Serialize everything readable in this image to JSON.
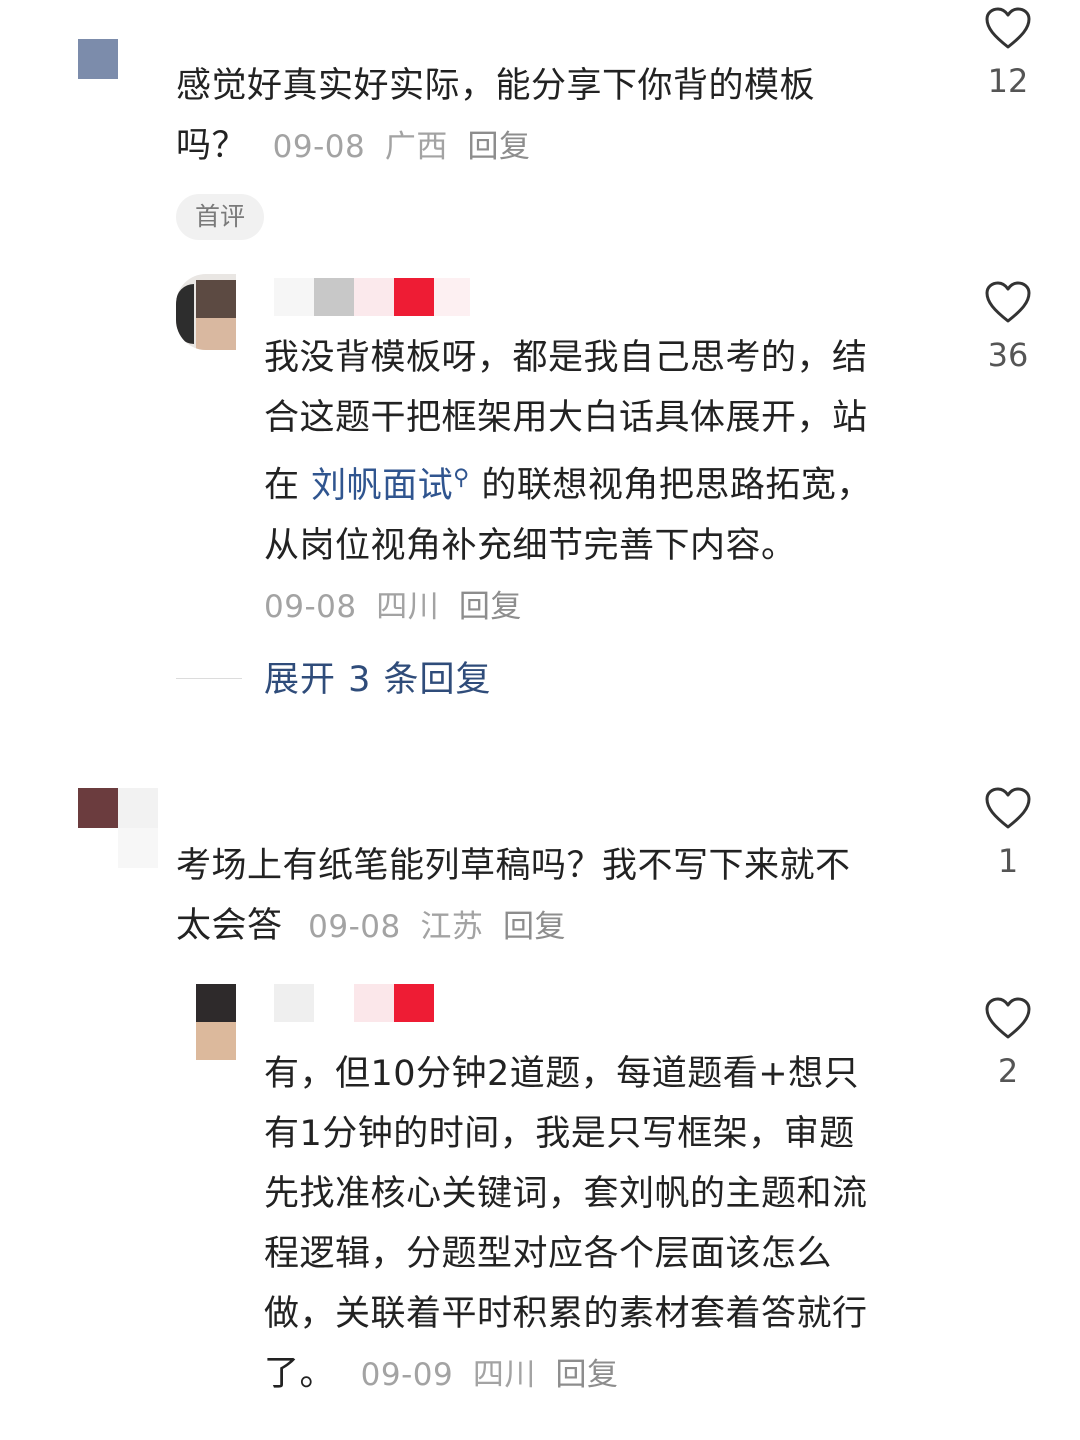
{
  "comments": [
    {
      "text_line1": "感觉好真实好实际，能分享下你背的模板",
      "text_line2": "吗？",
      "date": "09-08",
      "location": "广西",
      "reply_label": "回复",
      "likes": "12",
      "badge": "首评",
      "replies": [
        {
          "line1": "我没背模板呀，都是我自己思考的，结",
          "line2": "合这题干把框架用大白话具体展开，站",
          "line3_prefix": "在 ",
          "mention": "刘帆面试",
          "line3_suffix": " 的联想视角把思路拓宽，",
          "line4": "从岗位视角补充细节完善下内容。",
          "date": "09-08",
          "location": "四川",
          "reply_label": "回复",
          "likes": "36"
        }
      ],
      "expand_label": "展开 3 条回复"
    },
    {
      "text_line1": "考场上有纸笔能列草稿吗？我不写下来就不",
      "text_line2": "太会答",
      "date": "09-08",
      "location": "江苏",
      "reply_label": "回复",
      "likes": "1",
      "replies": [
        {
          "line1": "有，但10分钟2道题，每道题看+想只",
          "line2": "有1分钟的时间，我是只写框架，审题",
          "line3": "先找准核心关键词，套刘帆的主题和流",
          "line4": "程逻辑，分题型对应各个层面该怎么",
          "line5": "做，关联着平时积累的素材套着答就行",
          "line6": "了。",
          "date": "09-09",
          "location": "四川",
          "reply_label": "回复",
          "likes": "2"
        }
      ]
    }
  ],
  "icons": {
    "like": "heart-outline-icon",
    "mention": "search-icon"
  },
  "colors": {
    "mention": "#30558f",
    "meta": "#a3a3a3",
    "expand": "#2f4c7a"
  }
}
